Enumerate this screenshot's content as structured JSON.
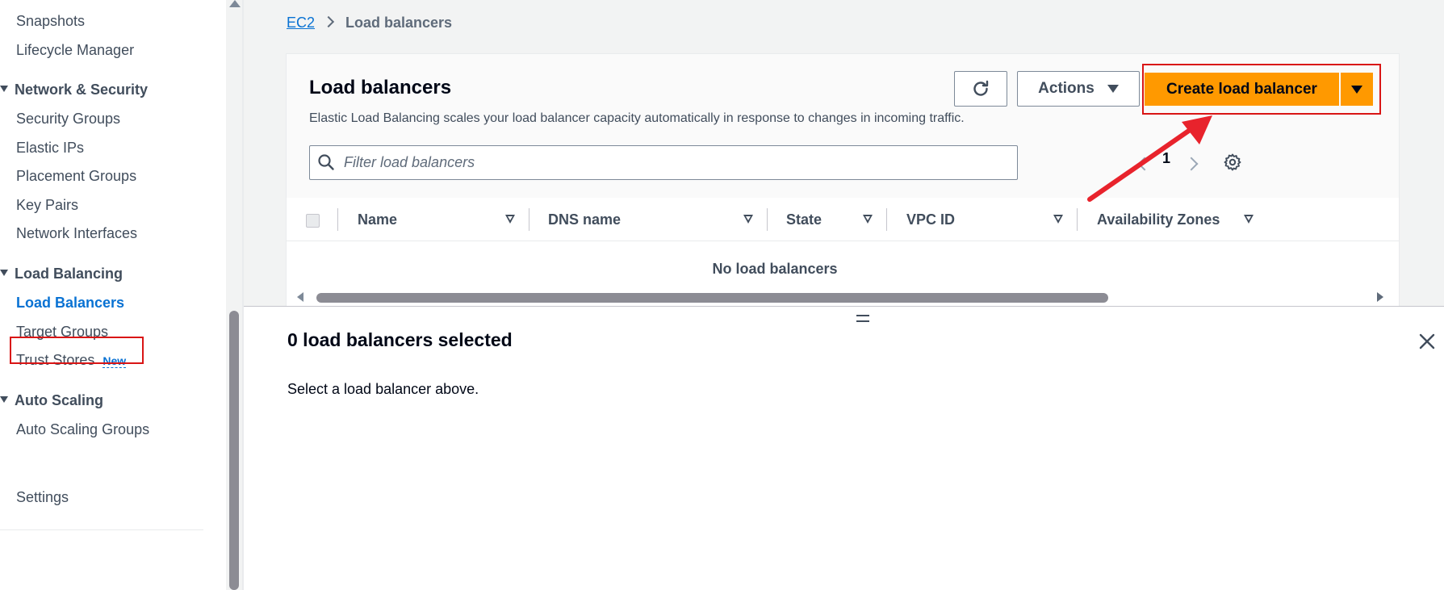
{
  "sidebar": {
    "items": {
      "snapshots": "Snapshots",
      "lifecycle_manager": "Lifecycle Manager",
      "security_groups": "Security Groups",
      "elastic_ips": "Elastic IPs",
      "placement_groups": "Placement Groups",
      "key_pairs": "Key Pairs",
      "network_interfaces": "Network Interfaces",
      "load_balancers": "Load Balancers",
      "target_groups": "Target Groups",
      "trust_stores": "Trust Stores",
      "auto_scaling_groups": "Auto Scaling Groups",
      "settings": "Settings"
    },
    "sections": {
      "network_security": "Network & Security",
      "load_balancing": "Load Balancing",
      "auto_scaling": "Auto Scaling"
    },
    "trust_stores_badge": "New",
    "active_item": "Load Balancers"
  },
  "breadcrumb": {
    "root": "EC2",
    "current": "Load balancers"
  },
  "load_balancers": {
    "title": "Load balancers",
    "description": "Elastic Load Balancing scales your load balancer capacity automatically in response to changes in incoming traffic.",
    "actions_label": "Actions",
    "create_label": "Create load balancer",
    "filter_placeholder": "Filter load balancers",
    "page_number": "1",
    "columns": {
      "name": "Name",
      "dns_name": "DNS name",
      "state": "State",
      "vpc_id": "VPC ID",
      "availability_zones": "Availability Zones"
    },
    "empty_message": "No load balancers"
  },
  "split_panel": {
    "title": "0 load balancers selected",
    "body": "Select a load balancer above."
  },
  "colors": {
    "primary_button": "#ff9900",
    "link": "#0972d3",
    "annotation": "#d91515"
  },
  "icons": [
    "refresh-icon",
    "caret-down-icon",
    "search-icon",
    "chevron-left-icon",
    "chevron-right-icon",
    "gear-icon",
    "sort-icon",
    "close-icon",
    "resize-handle-icon"
  ]
}
